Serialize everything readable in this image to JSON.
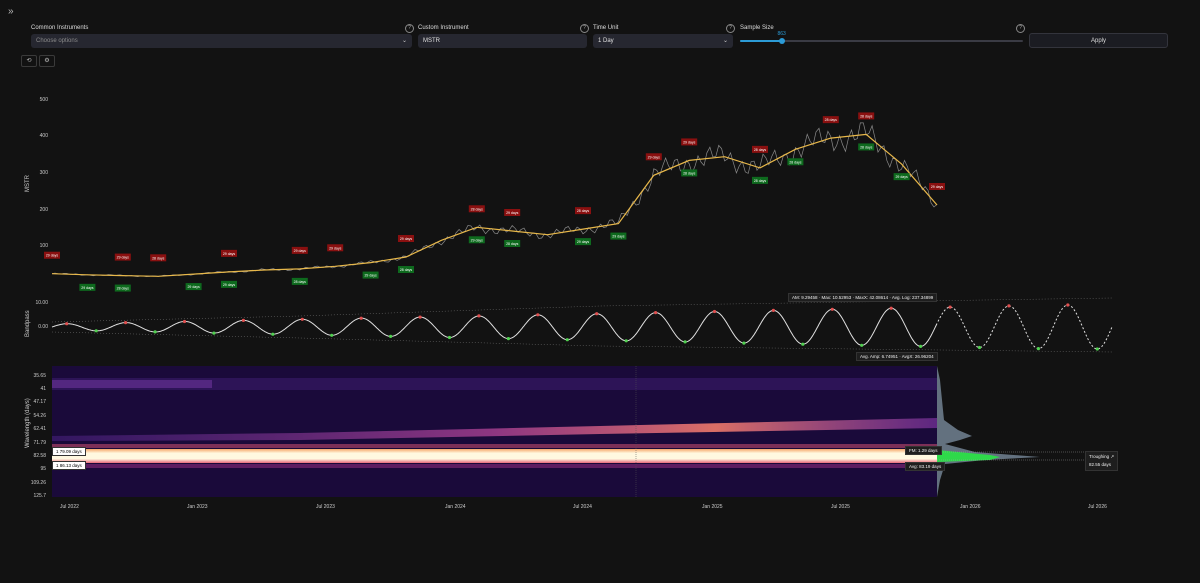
{
  "sidebar_toggle": "»",
  "controls": {
    "common": {
      "label": "Common Instruments",
      "placeholder": "Choose options"
    },
    "custom": {
      "label": "Custom Instrument",
      "value": "MSTR"
    },
    "unit": {
      "label": "Time Unit",
      "value": "1 Day"
    },
    "sample": {
      "label": "Sample Size",
      "value": "863",
      "fraction": 0.15
    },
    "apply_label": "Apply",
    "help": "?"
  },
  "tools": {
    "reset": "⟲",
    "settings": "⚙"
  },
  "price_panel": {
    "ylabel": "MSTR",
    "yticks": [
      "500",
      "400",
      "300",
      "200",
      "100"
    ]
  },
  "bandpass_panel": {
    "ylabel": "Bandpass",
    "yticks": [
      "10.00",
      "0.00"
    ],
    "top_stats": {
      "am": "AM: 9.29458",
      "max": "Max: 10.52953",
      "maxx": "MaxX: 42.08614",
      "avglog": "Avg. Log: 237.34899"
    },
    "bottom_stats": {
      "avgamp": "Avg. Amp: 6.74951",
      "avgf": "AvgX: 26.96204"
    }
  },
  "spectrum_panel": {
    "ylabel": "Wavelength (days)",
    "yticks": [
      "35.65",
      "41",
      "47.17",
      "54.26",
      "62.41",
      "71.79",
      "82.58",
      "95",
      "109.26",
      "125.7"
    ],
    "left_labels": [
      "1 79.09 days",
      "1 86.13 days"
    ],
    "fm_label": "FM: 1.29 days",
    "avg_label": "Avg: 83.19 days",
    "troughing": "Troughing ↗",
    "troughing_days": "82.55 days"
  },
  "x_axis": [
    "Jul 2022",
    "Jan 2023",
    "Jul 2023",
    "Jan 2024",
    "Jul 2024",
    "Jan 2025",
    "Jul 2025",
    "Jan 2026",
    "Jul 2026"
  ],
  "chart_data": {
    "type": "line",
    "ylabel": "MSTR",
    "ylim": [
      0,
      560
    ],
    "series": [
      {
        "values": [
          25,
          22,
          20,
          18,
          24,
          30,
          35,
          38,
          45,
          55,
          70,
          115,
          150,
          140,
          130,
          145,
          160,
          290,
          330,
          340,
          310,
          360,
          390,
          400,
          320,
          210
        ]
      }
    ],
    "peak_tags": [
      "29 days",
      "29 days",
      "28 days",
      "29 days",
      "29 days",
      "29 days",
      "29 days",
      "28 days",
      "29 days",
      "28 days",
      "29 days",
      "29 days",
      "28 days",
      "28 days",
      "28 days",
      "29 days"
    ],
    "trough_tags": [
      "29 days",
      "28 days",
      "29 days",
      "29 days",
      "28 days",
      "29 days",
      "28 days",
      "29 days",
      "28 days",
      "29 days",
      "29 days",
      "28 days",
      "28 days",
      "28 days",
      "28 days",
      "29 days"
    ]
  }
}
